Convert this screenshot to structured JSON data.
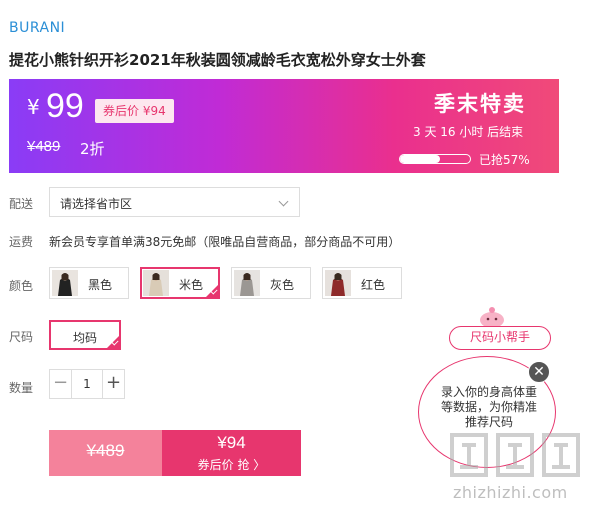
{
  "product": {
    "brand": "BURANI",
    "title": "提花小熊针织开衫2021年秋装圆领减龄毛衣宽松外穿女士外套"
  },
  "promo": {
    "yen": "¥",
    "price": "99",
    "after_coupon": "券后价 ¥94",
    "original_price": "¥489",
    "discount": "2折",
    "event_name": "季末特卖",
    "countdown": "3 天 16 小时 后结束",
    "sold_percent": 57,
    "sold_text": "已抢57%",
    "colors": {
      "accent": "#e7366e",
      "gradient_start": "#8a3cf6",
      "gradient_end": "#f04a79"
    }
  },
  "delivery": {
    "label": "配送",
    "placeholder": "请选择省市区"
  },
  "shipping": {
    "label": "运费",
    "text": "新会员专享首单满38元免邮（限唯品自营商品，部分商品不可用）"
  },
  "color_option": {
    "label": "颜色",
    "options": [
      {
        "name": "黑色",
        "selected": false
      },
      {
        "name": "米色",
        "selected": true
      },
      {
        "name": "灰色",
        "selected": false
      },
      {
        "name": "红色",
        "selected": false
      }
    ]
  },
  "size_option": {
    "label": "尺码",
    "options": [
      {
        "name": "均码",
        "selected": true
      }
    ]
  },
  "quantity": {
    "label": "数量",
    "value": "1",
    "minus": "−",
    "plus": "+"
  },
  "buy": {
    "original": "¥489",
    "price": "¥94",
    "action": "券后价 抢 〉"
  },
  "size_helper": {
    "button": "尺码小帮手",
    "bubble_text": "录入你的身高体重等数据，为你精准推荐尺码",
    "close": "✕"
  },
  "watermark": {
    "text": "zhizhizhi.com"
  }
}
